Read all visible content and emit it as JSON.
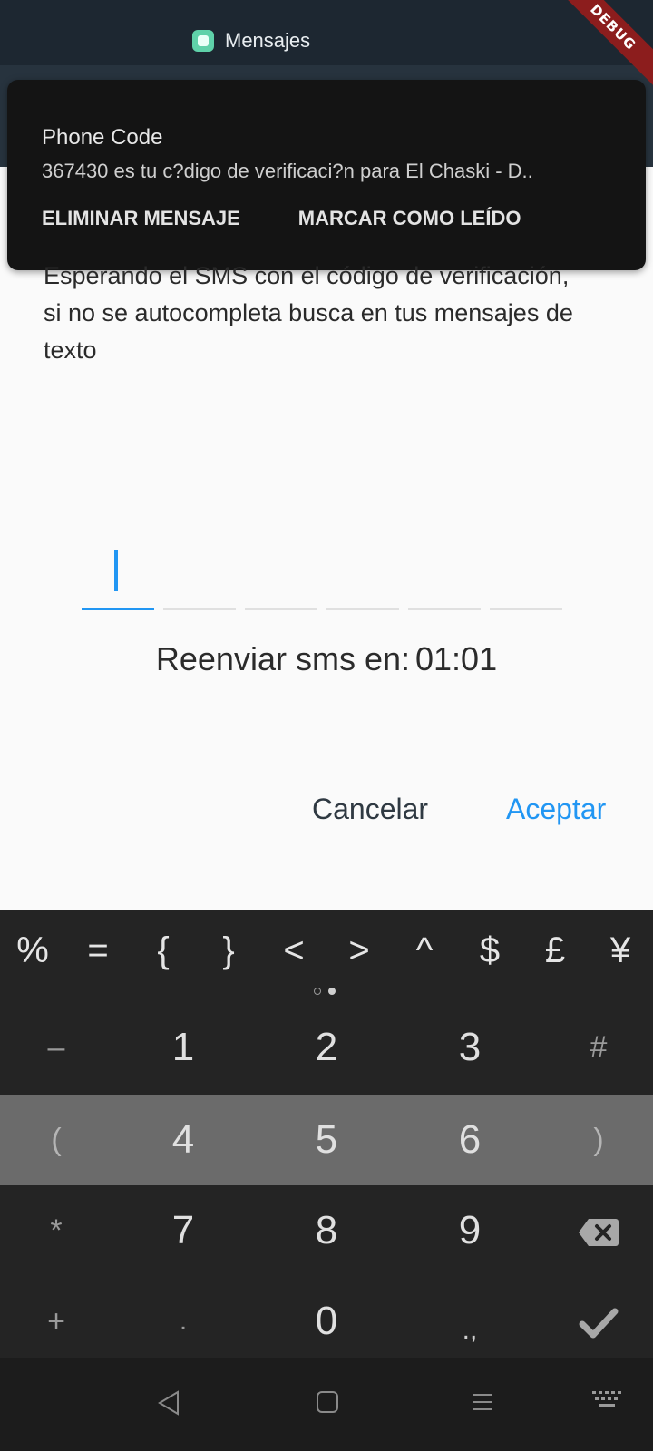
{
  "status_bar": {
    "app_name": "Mensajes",
    "debug_banner": "DEBUG"
  },
  "notification": {
    "title": "Phone Code",
    "body": "367430 es tu c?digo de verificaci?n para El Chaski - D..",
    "actions": [
      "ELIMINAR MENSAJE",
      "MARCAR COMO LEÍDO"
    ]
  },
  "content": {
    "message": "Esperando el SMS con el código de verificación, si no se autocompleta busca en tus mensajes de texto",
    "resend_label": "Reenviar sms en:",
    "resend_timer": "01:01",
    "cancel_label": "Cancelar",
    "accept_label": "Aceptar",
    "accent_color": "#2196f3"
  },
  "keyboard": {
    "symbols": [
      "%",
      "=",
      "{",
      "}",
      "<",
      ">",
      "^",
      "$",
      "£",
      "¥"
    ],
    "rows": [
      {
        "left": "–",
        "keys": [
          "1",
          "2",
          "3"
        ],
        "right": "#"
      },
      {
        "left": "(",
        "keys": [
          "4",
          "5",
          "6"
        ],
        "right": ")"
      },
      {
        "left": "*",
        "keys": [
          "7",
          "8",
          "9"
        ],
        "right": "backspace-icon"
      },
      {
        "left": "+",
        "keys": [
          ".",
          "0",
          ".,"
        ],
        "right": "check-icon"
      }
    ]
  },
  "nav_bar": {
    "icons": [
      "back-icon",
      "home-icon",
      "recents-icon",
      "keyboard-switch-icon"
    ]
  }
}
